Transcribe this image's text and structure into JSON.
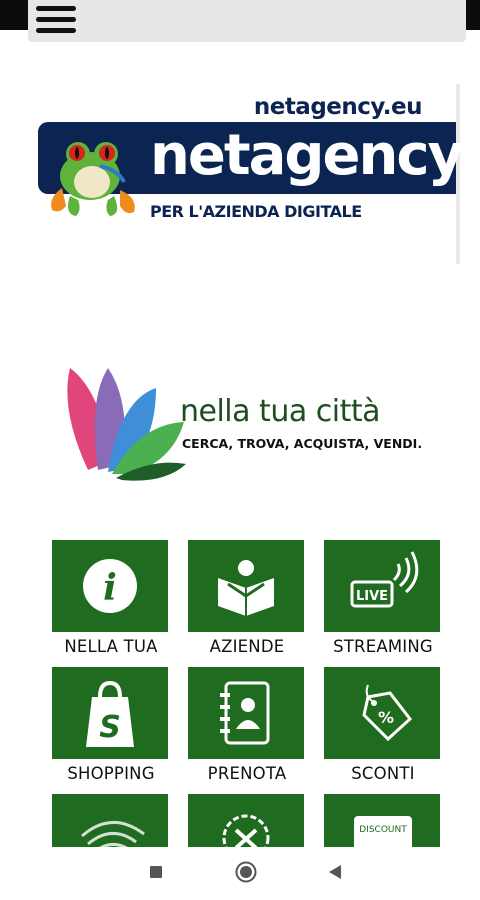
{
  "header": {
    "menu_icon": "hamburger-menu-icon"
  },
  "banner": {
    "url": "netagency.eu",
    "name": "netagency",
    "tagline": "PER L'AZIENDA DIGITALE",
    "colors": {
      "navy": "#0b2451"
    }
  },
  "city_logo": {
    "title": "nella tua città",
    "subtitle": "CERCA, TROVA, ACQUISTA, VENDI.",
    "colors": {
      "green": "#1f4d1f",
      "pink": "#e0457b",
      "purple": "#8a6bb8",
      "blue": "#3f8fd8",
      "light_green": "#4caf50",
      "dark_green": "#1f5d2a"
    }
  },
  "tiles": [
    {
      "label": "NELLA TUA",
      "icon": "info-icon"
    },
    {
      "label": "AZIENDE",
      "icon": "open-book-reader-icon"
    },
    {
      "label": "STREAMING",
      "icon": "live-broadcast-icon",
      "icon_text": "LIVE"
    },
    {
      "label": "SHOPPING",
      "icon": "shopping-bag-icon"
    },
    {
      "label": "PRENOTA",
      "icon": "contact-book-icon"
    },
    {
      "label": "SCONTI",
      "icon": "discount-tag-icon"
    },
    {
      "label": "",
      "icon": "signal-waves-icon"
    },
    {
      "label": "",
      "icon": "badge-check-icon"
    },
    {
      "label": "",
      "icon": "discount-card-icon",
      "icon_text": "DISCOUNT"
    }
  ],
  "tile_color": "#1f6b1f",
  "system_nav": {
    "buttons": [
      "recents-square-icon",
      "home-circle-icon",
      "back-triangle-icon"
    ]
  }
}
